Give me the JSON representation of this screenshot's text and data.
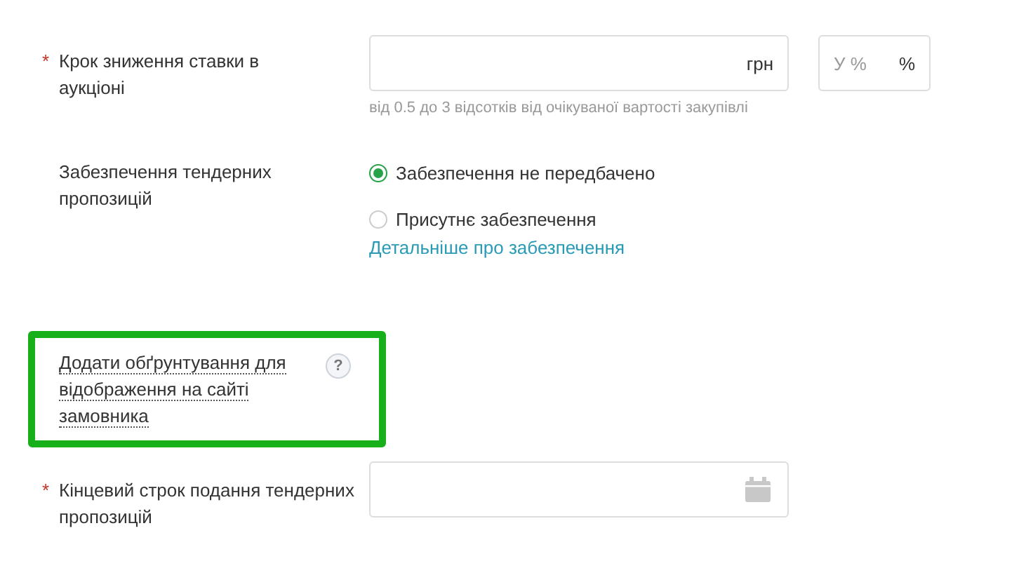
{
  "bid_step": {
    "required_mark": "*",
    "label": "Крок зниження ставки в аукціоні",
    "amount_unit": "грн",
    "percent_placeholder": "У %",
    "percent_unit": "%",
    "hint": "від 0.5 до 3 відсотків від очікуваної вартості закупівлі"
  },
  "security": {
    "label": "Забезпечення тендерних пропозицій",
    "options": [
      {
        "label": "Забезпечення не передбачено",
        "selected": true
      },
      {
        "label": "Присутнє забезпечення",
        "selected": false
      }
    ],
    "link": "Детальніше про забезпечення"
  },
  "justification": {
    "label": "Додати обґрунтування для відображення на сайті замовника",
    "highlighted": true,
    "help": "?"
  },
  "deadline": {
    "required_mark": "*",
    "label": "Кінцевий строк подання тендерних пропозицій"
  }
}
